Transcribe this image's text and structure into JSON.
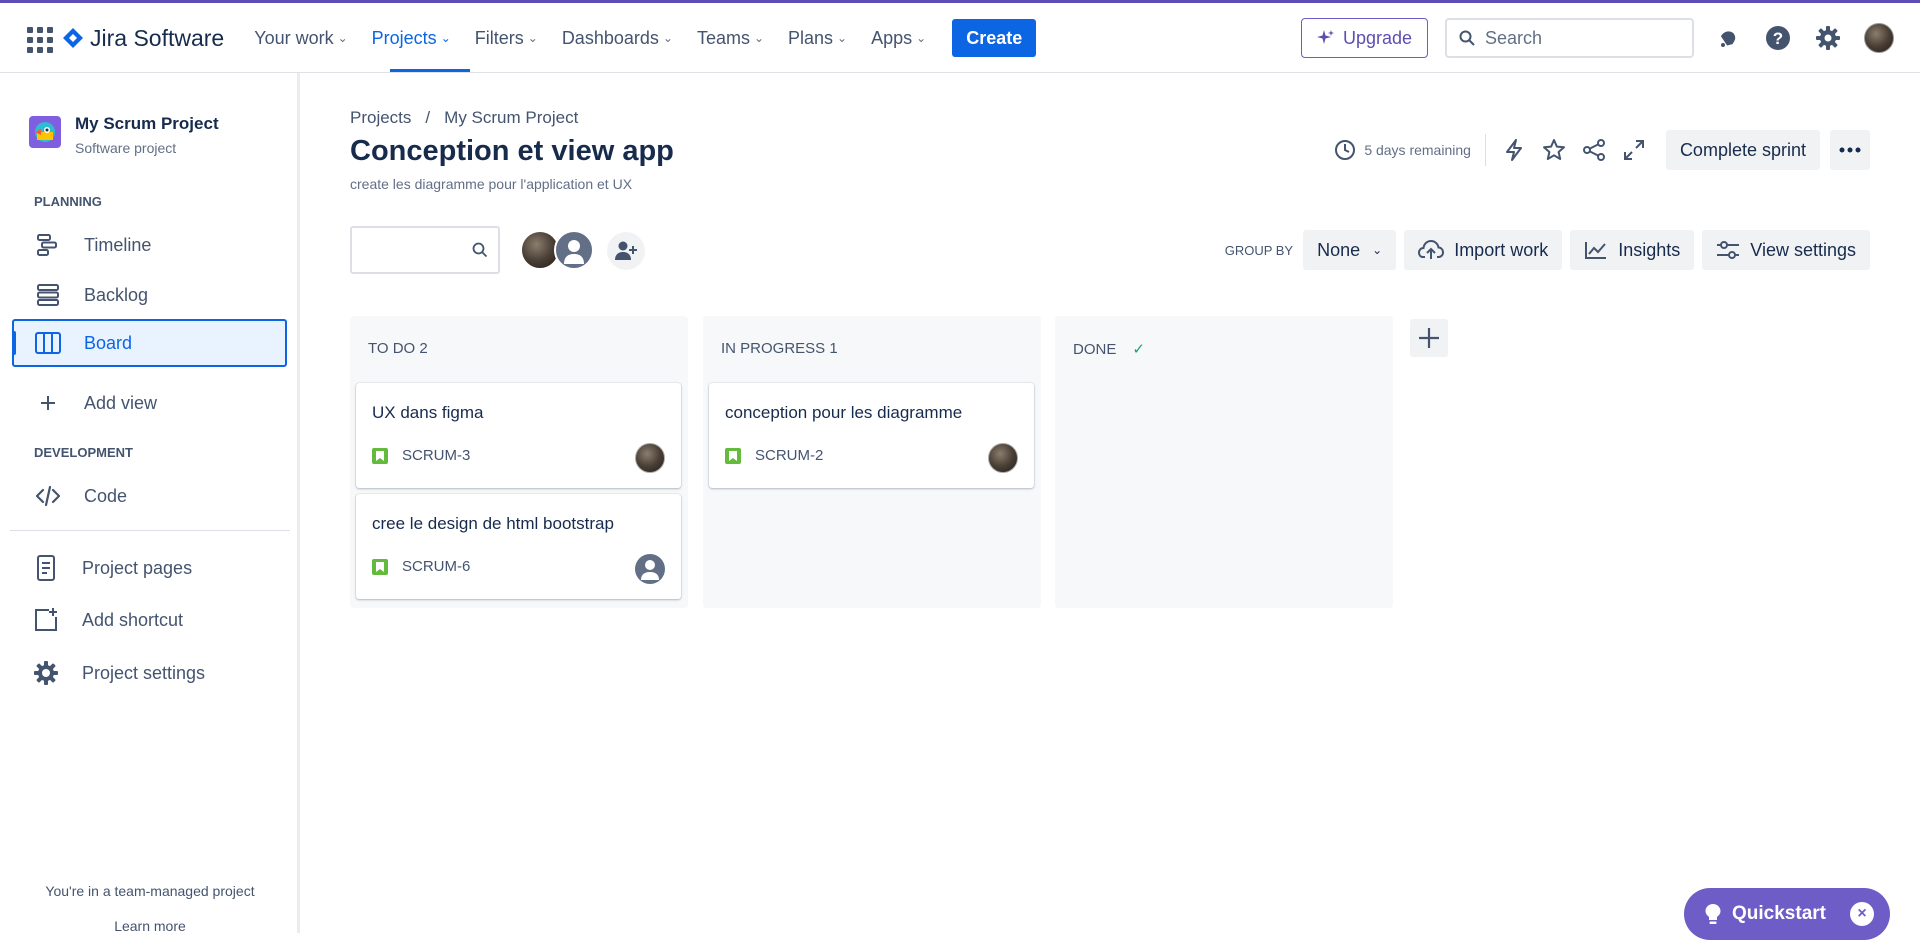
{
  "topnav": {
    "logo_text": "Jira Software",
    "items": [
      {
        "label": "Your work"
      },
      {
        "label": "Projects"
      },
      {
        "label": "Filters"
      },
      {
        "label": "Dashboards"
      },
      {
        "label": "Teams"
      },
      {
        "label": "Plans"
      },
      {
        "label": "Apps"
      }
    ],
    "create_label": "Create",
    "upgrade_label": "Upgrade",
    "search_placeholder": "Search"
  },
  "sidebar": {
    "project_name": "My Scrum Project",
    "project_type": "Software project",
    "planning_label": "PLANNING",
    "planning_items": [
      {
        "label": "Timeline"
      },
      {
        "label": "Backlog"
      },
      {
        "label": "Board"
      }
    ],
    "add_view_label": "Add view",
    "development_label": "DEVELOPMENT",
    "code_label": "Code",
    "project_pages_label": "Project pages",
    "add_shortcut_label": "Add shortcut",
    "project_settings_label": "Project settings",
    "team_note": "You're in a team-managed project",
    "learn_more": "Learn more"
  },
  "header": {
    "breadcrumb": [
      "Projects",
      "My Scrum Project"
    ],
    "breadcrumb_sep": "/",
    "title": "Conception et view app",
    "subtitle": "create les diagramme pour l'application et UX",
    "remaining": "5 days remaining",
    "complete_sprint": "Complete sprint"
  },
  "toolbar": {
    "group_by_label": "GROUP BY",
    "group_by_value": "None",
    "import_work": "Import work",
    "insights": "Insights",
    "view_settings": "View settings"
  },
  "board": {
    "columns": [
      {
        "header": "TO DO 2",
        "cards": [
          {
            "title": "UX dans figma",
            "key": "SCRUM-3",
            "assignee": "photo"
          },
          {
            "title": "cree le design de html bootstrap",
            "key": "SCRUM-6",
            "assignee": "default"
          }
        ]
      },
      {
        "header": "IN PROGRESS 1",
        "cards": [
          {
            "title": "conception pour les diagramme",
            "key": "SCRUM-2",
            "assignee": "photo"
          }
        ]
      },
      {
        "header": "DONE",
        "done_check": "✓",
        "cards": []
      }
    ]
  },
  "quickstart": {
    "label": "Quickstart",
    "close": "×"
  },
  "colors": {
    "brand_blue": "#0c66e4",
    "purple": "#6e5dc6",
    "story_green": "#63ba3c",
    "column_bg": "#f7f8f9"
  }
}
